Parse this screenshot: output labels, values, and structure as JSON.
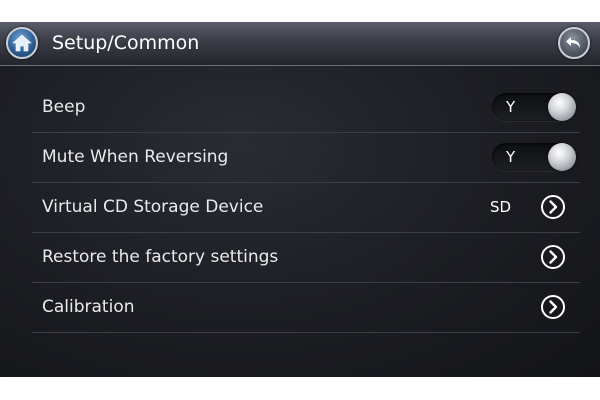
{
  "header": {
    "title": "Setup/Common",
    "home_icon": "home-icon",
    "back_icon": "back-arrow-icon"
  },
  "settings": [
    {
      "label": "Beep",
      "control": "toggle",
      "value": "Y"
    },
    {
      "label": "Mute When Reversing",
      "control": "toggle",
      "value": "Y"
    },
    {
      "label": "Virtual CD Storage Device",
      "control": "arrow",
      "value": "SD"
    },
    {
      "label": "Restore the factory settings",
      "control": "arrow",
      "value": ""
    },
    {
      "label": "Calibration",
      "control": "arrow",
      "value": ""
    }
  ],
  "colors": {
    "background": "#1c1d22",
    "header": "#3a3d46",
    "text": "#e9eaee",
    "accent": "#2f5f93"
  }
}
